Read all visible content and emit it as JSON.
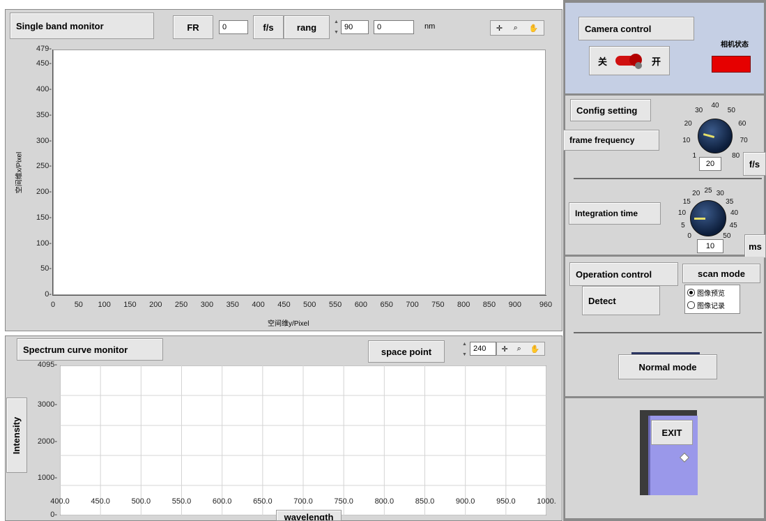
{
  "single_band": {
    "title": "Single band monitor",
    "fr_label": "FR",
    "fr_value": "0",
    "fps_unit": "f/s",
    "rang_label": "rang",
    "rang_value": "90",
    "nm_value": "0",
    "nm_unit": "nm",
    "y_label": "空间维x/Pixel",
    "x_label": "空间维y/Pixel"
  },
  "spectrum": {
    "title": "Spectrum curve monitor",
    "space_point_label": "space point",
    "space_point_value": "240",
    "y_label": "Intensity",
    "x_label": "wavelength"
  },
  "camera": {
    "title": "Camera control",
    "switch_off": "关",
    "switch_on": "开",
    "status_label": "相机状态",
    "status_color": "#e60000"
  },
  "config": {
    "title": "Config setting",
    "frame_label": "frame frequency",
    "frame_value": "20",
    "frame_unit": "f/s",
    "integ_label": "Integration time",
    "integ_value": "10",
    "integ_unit": "ms"
  },
  "operation": {
    "title": "Operation control",
    "scan_mode_label": "scan mode",
    "detect_label": "Detect",
    "radio_preview": "图像预览",
    "radio_record": "图像记录",
    "selected": "preview"
  },
  "mode_button": "Normal mode",
  "exit_label": "EXIT",
  "chart_data": [
    {
      "type": "scatter",
      "title": "Single band monitor",
      "xlabel": "空间维y/Pixel",
      "ylabel": "空间维x/Pixel",
      "xlim": [
        0,
        960
      ],
      "ylim": [
        0,
        479
      ],
      "xticks": [
        "0",
        "50",
        "100",
        "150",
        "200",
        "250",
        "300",
        "350",
        "400",
        "450",
        "500",
        "550",
        "600",
        "650",
        "700",
        "750",
        "800",
        "850",
        "900",
        "960"
      ],
      "yticks": [
        "0",
        "50",
        "100",
        "150",
        "200",
        "250",
        "300",
        "350",
        "400",
        "450",
        "479"
      ],
      "grid": false,
      "series": []
    },
    {
      "type": "line",
      "title": "Spectrum curve monitor",
      "xlabel": "wavelength",
      "ylabel": "Intensity",
      "xlim": [
        400,
        1000
      ],
      "ylim": [
        0,
        4095
      ],
      "xticks": [
        "400.0",
        "450.0",
        "500.0",
        "550.0",
        "600.0",
        "650.0",
        "700.0",
        "750.0",
        "800.0",
        "850.0",
        "900.0",
        "950.0",
        "1000."
      ],
      "yticks": [
        "0",
        "1000",
        "2000",
        "3000",
        "4095"
      ],
      "grid": true,
      "series": []
    }
  ],
  "frame_dial": {
    "ticks": [
      "1",
      "10",
      "20",
      "30",
      "40",
      "50",
      "60",
      "70",
      "80"
    ]
  },
  "integ_dial": {
    "ticks": [
      "0",
      "5",
      "10",
      "15",
      "20",
      "25",
      "30",
      "35",
      "40",
      "45",
      "50"
    ]
  }
}
